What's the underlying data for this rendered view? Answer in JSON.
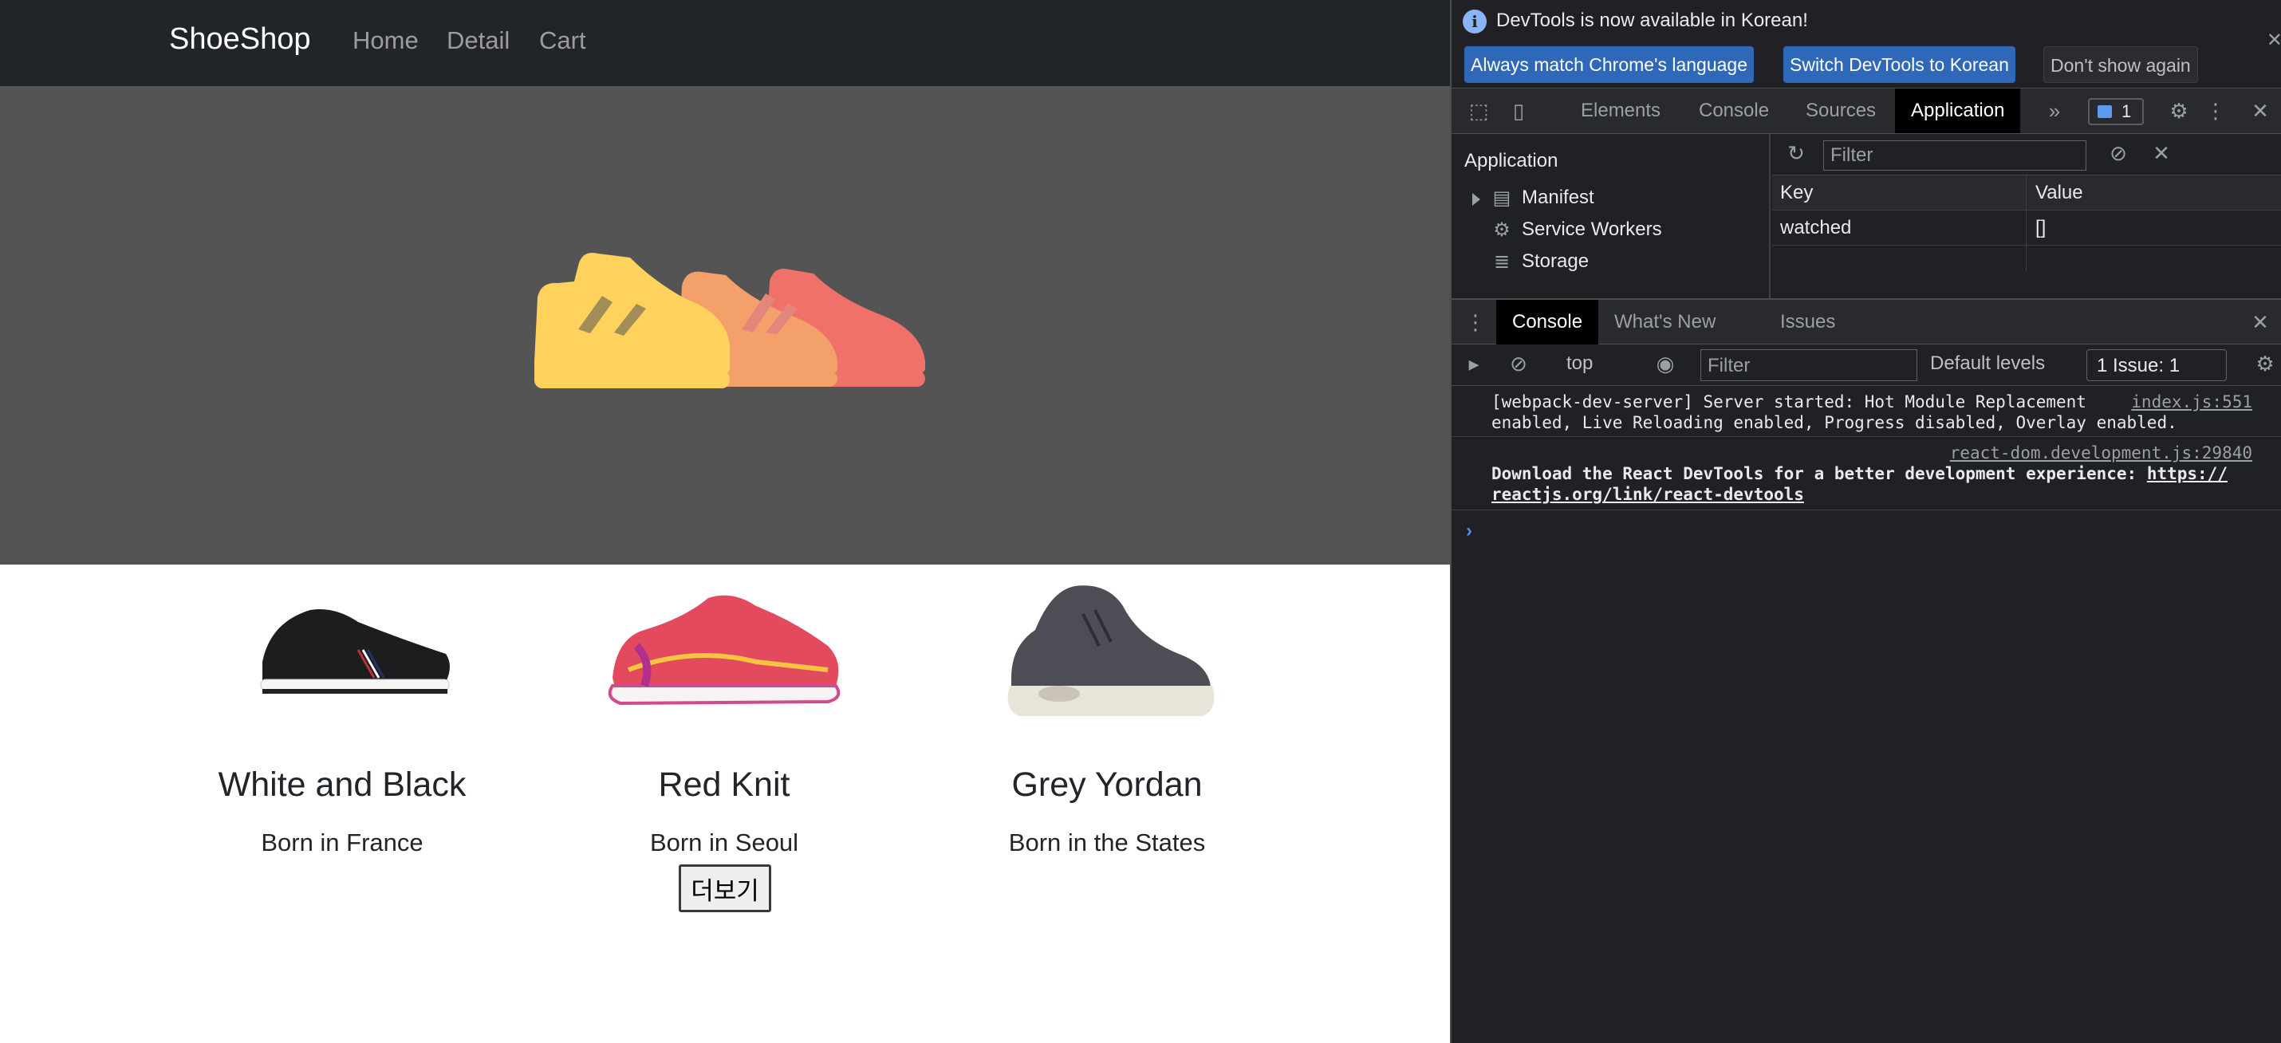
{
  "navbar": {
    "brand": "ShoeShop",
    "links": [
      "Home",
      "Detail",
      "Cart"
    ]
  },
  "hero": {
    "image": "shoes-illustration"
  },
  "products": [
    {
      "title": "White and Black",
      "content": "Born in France",
      "image": "black-sneaker"
    },
    {
      "title": "Red Knit",
      "content": "Born in Seoul",
      "image": "red-running-shoe"
    },
    {
      "title": "Grey Yordan",
      "content": "Born in the States",
      "image": "grey-high-top"
    }
  ],
  "more_button": "더보기",
  "devtools": {
    "infobar": {
      "message": "DevTools is now available in Korean!",
      "buttons": [
        "Always match Chrome's language",
        "Switch DevTools to Korean",
        "Don't show again"
      ]
    },
    "tabs": [
      "Elements",
      "Console",
      "Sources",
      "Application"
    ],
    "active_tab": "Application",
    "issue_badge_count": "1",
    "application": {
      "title": "Application",
      "tree": [
        "Manifest",
        "Service Workers",
        "Storage"
      ],
      "filter_placeholder": "Filter",
      "columns": [
        "Key",
        "Value"
      ],
      "rows": [
        {
          "key": "watched",
          "value": "[]"
        }
      ]
    },
    "drawer_tabs": [
      "Console",
      "What's New",
      "Issues"
    ],
    "console": {
      "context": "top",
      "filter_placeholder": "Filter",
      "levels": "Default levels",
      "issues_label": "1 Issue:",
      "issues_count": "1",
      "messages": [
        {
          "lines": [
            "[webpack-dev-server] Server started: Hot Module Replacement",
            "enabled, Live Reloading enabled, Progress disabled, Overlay enabled."
          ],
          "source": "index.js:551"
        },
        {
          "source": "react-dom.development.js:29840",
          "text": "Download the React DevTools for a better development experience:",
          "link_part1": "https://",
          "link_part2": "reactjs.org/link/react-devtools"
        }
      ]
    }
  },
  "colors": {
    "navbar": "#212529",
    "hero": "#545454",
    "shoe_yellow": "#ffd25e",
    "shoe_orange": "#f3a06a",
    "shoe_red": "#f0706a",
    "devtools_bg": "#202124",
    "devtools_accent": "#2f68b8"
  }
}
